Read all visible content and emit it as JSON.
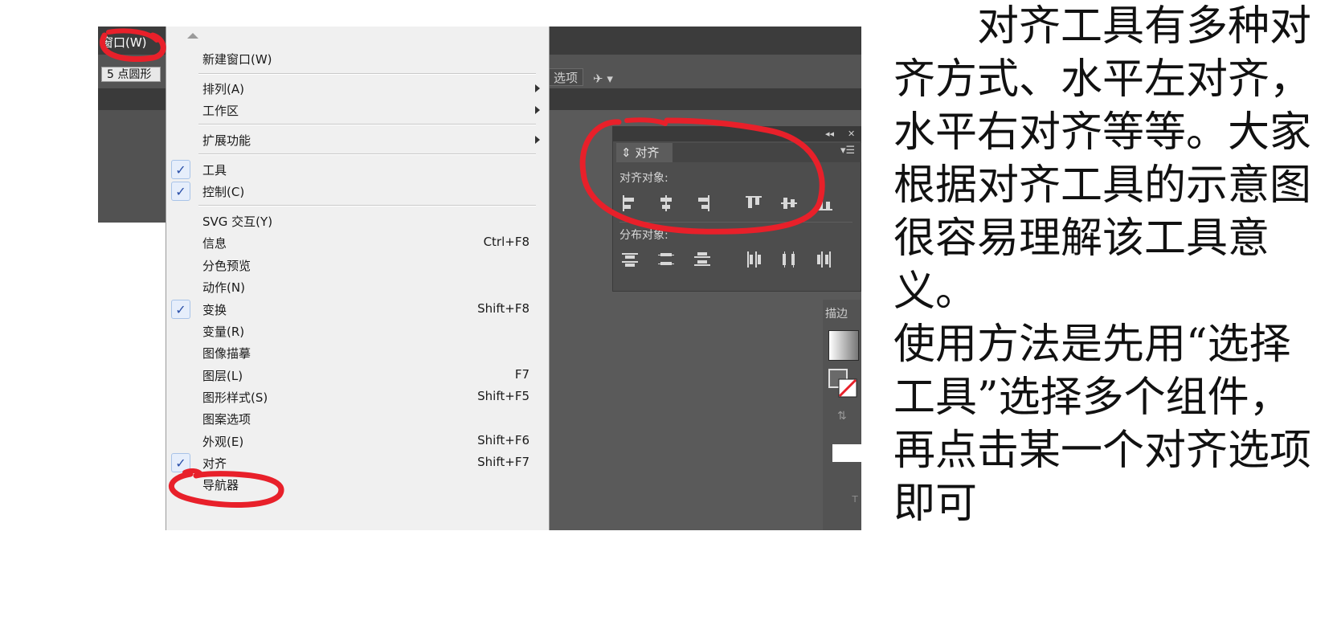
{
  "menubar": {
    "window_menu": "窗口(W)"
  },
  "control_bar": {
    "stroke_field": "5 点圆形",
    "options_button": "选项",
    "icon": "pin-dropdown-icon"
  },
  "window_menu": {
    "items": [
      {
        "label": "新建窗口(W)",
        "shortcut": "",
        "checked": false,
        "submenu": false
      },
      {
        "label": "排列(A)",
        "shortcut": "",
        "checked": false,
        "submenu": true
      },
      {
        "label": "工作区",
        "shortcut": "",
        "checked": false,
        "submenu": true
      },
      {
        "label": "扩展功能",
        "shortcut": "",
        "checked": false,
        "submenu": true
      },
      {
        "label": "工具",
        "shortcut": "",
        "checked": true,
        "submenu": false
      },
      {
        "label": "控制(C)",
        "shortcut": "",
        "checked": true,
        "submenu": false
      },
      {
        "label": "SVG 交互(Y)",
        "shortcut": "",
        "checked": false,
        "submenu": false
      },
      {
        "label": "信息",
        "shortcut": "Ctrl+F8",
        "checked": false,
        "submenu": false
      },
      {
        "label": "分色预览",
        "shortcut": "",
        "checked": false,
        "submenu": false
      },
      {
        "label": "动作(N)",
        "shortcut": "",
        "checked": false,
        "submenu": false
      },
      {
        "label": "变换",
        "shortcut": "Shift+F8",
        "checked": true,
        "submenu": false
      },
      {
        "label": "变量(R)",
        "shortcut": "",
        "checked": false,
        "submenu": false
      },
      {
        "label": "图像描摹",
        "shortcut": "",
        "checked": false,
        "submenu": false
      },
      {
        "label": "图层(L)",
        "shortcut": "F7",
        "checked": false,
        "submenu": false
      },
      {
        "label": "图形样式(S)",
        "shortcut": "Shift+F5",
        "checked": false,
        "submenu": false
      },
      {
        "label": "图案选项",
        "shortcut": "",
        "checked": false,
        "submenu": false
      },
      {
        "label": "外观(E)",
        "shortcut": "Shift+F6",
        "checked": false,
        "submenu": false
      },
      {
        "label": "对齐",
        "shortcut": "Shift+F7",
        "checked": true,
        "submenu": false
      },
      {
        "label": "导航器",
        "shortcut": "",
        "checked": false,
        "submenu": false
      }
    ]
  },
  "align_panel": {
    "tab": "对齐",
    "align_objects_label": "对齐对象:",
    "distribute_objects_label": "分布对象:",
    "align_icons": [
      "horizontal-align-left-icon",
      "horizontal-align-center-icon",
      "horizontal-align-right-icon",
      "vertical-align-top-icon",
      "vertical-align-center-icon",
      "vertical-align-bottom-icon"
    ],
    "distribute_icons": [
      "vertical-distribute-top-icon",
      "vertical-distribute-center-icon",
      "vertical-distribute-bottom-icon",
      "horizontal-distribute-left-icon",
      "horizontal-distribute-center-icon",
      "horizontal-distribute-right-icon"
    ]
  },
  "side_panel": {
    "stroke_label": "描边"
  },
  "annotation_color": "#e8202a",
  "description": {
    "paragraph1": "对齐工具有多种对齐方式、水平左对齐，水平右对齐等等。大家根据对齐工具的示意图很容易理解该工具意义。",
    "paragraph2": "使用方法是先用“选择工具”选择多个组件，再点击某一个对齐选项即可"
  }
}
